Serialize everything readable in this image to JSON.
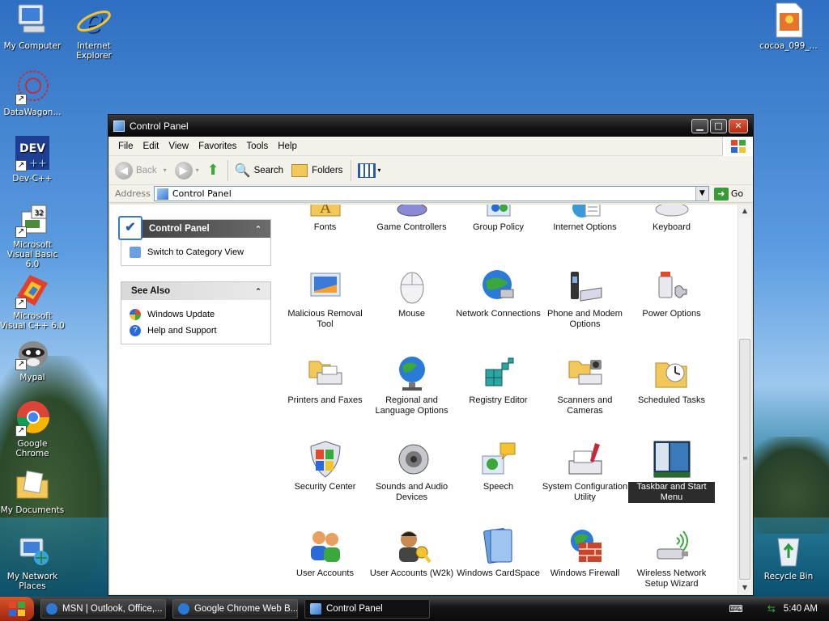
{
  "desktop": {
    "icons": [
      {
        "label": "My Computer",
        "icon": "my-computer-icon"
      },
      {
        "label": "Internet Explorer",
        "icon": "internet-explorer-icon"
      },
      {
        "label": "DataWagon...",
        "icon": "datawagon-icon"
      },
      {
        "label": "Dev-C++",
        "icon": "dev-cpp-icon"
      },
      {
        "label": "Microsoft Visual Basic 6.0",
        "icon": "visual-basic-icon"
      },
      {
        "label": "Microsoft Visual C++ 6.0",
        "icon": "visual-cpp-icon"
      },
      {
        "label": "Mypal",
        "icon": "mypal-icon"
      },
      {
        "label": "Google Chrome",
        "icon": "chrome-icon"
      },
      {
        "label": "My Documents",
        "icon": "my-documents-icon"
      },
      {
        "label": "My Network Places",
        "icon": "network-places-icon"
      },
      {
        "label": "cocoa_099_...",
        "icon": "image-file-icon"
      },
      {
        "label": "Recycle Bin",
        "icon": "recycle-bin-icon"
      }
    ]
  },
  "window": {
    "title": "Control Panel",
    "menu": [
      "File",
      "Edit",
      "View",
      "Favorites",
      "Tools",
      "Help"
    ],
    "toolbar": {
      "back": "Back",
      "search": "Search",
      "folders": "Folders"
    },
    "address": {
      "label": "Address",
      "value": "Control Panel",
      "go": "Go"
    },
    "taskpane": {
      "control_panel_title": "Control Panel",
      "switch_view": "Switch to Category View",
      "see_also_title": "See Also",
      "see_also_links": [
        "Windows Update",
        "Help and Support"
      ]
    },
    "items": [
      {
        "label": "Fonts",
        "icon": "fonts-icon"
      },
      {
        "label": "Game Controllers",
        "icon": "game-controllers-icon"
      },
      {
        "label": "Group Policy",
        "icon": "group-policy-icon"
      },
      {
        "label": "Internet Options",
        "icon": "internet-options-icon"
      },
      {
        "label": "Keyboard",
        "icon": "keyboard-icon"
      },
      {
        "label": "Malicious Removal Tool",
        "icon": "malicious-removal-icon"
      },
      {
        "label": "Mouse",
        "icon": "mouse-icon"
      },
      {
        "label": "Network Connections",
        "icon": "network-connections-icon"
      },
      {
        "label": "Phone and Modem Options",
        "icon": "phone-modem-icon"
      },
      {
        "label": "Power Options",
        "icon": "power-options-icon"
      },
      {
        "label": "Printers and Faxes",
        "icon": "printers-icon"
      },
      {
        "label": "Regional and Language Options",
        "icon": "regional-icon"
      },
      {
        "label": "Registry Editor",
        "icon": "registry-icon"
      },
      {
        "label": "Scanners and Cameras",
        "icon": "scanners-icon"
      },
      {
        "label": "Scheduled Tasks",
        "icon": "scheduled-tasks-icon"
      },
      {
        "label": "Security Center",
        "icon": "security-center-icon"
      },
      {
        "label": "Sounds and Audio Devices",
        "icon": "sounds-icon"
      },
      {
        "label": "Speech",
        "icon": "speech-icon"
      },
      {
        "label": "System Configuration Utility",
        "icon": "system-config-icon"
      },
      {
        "label": "Taskbar and Start Menu",
        "icon": "taskbar-icon",
        "selected": true
      },
      {
        "label": "User Accounts",
        "icon": "user-accounts-icon"
      },
      {
        "label": "User Accounts (W2k)",
        "icon": "user-accounts-w2k-icon"
      },
      {
        "label": "Windows CardSpace",
        "icon": "cardspace-icon"
      },
      {
        "label": "Windows Firewall",
        "icon": "firewall-icon"
      },
      {
        "label": "Wireless Network Setup Wizard",
        "icon": "wireless-icon"
      }
    ]
  },
  "taskbar": {
    "tasks": [
      {
        "label": "MSN | Outlook, Office,..."
      },
      {
        "label": "Google Chrome Web B..."
      },
      {
        "label": "Control Panel"
      }
    ],
    "clock": "5:40 AM"
  }
}
